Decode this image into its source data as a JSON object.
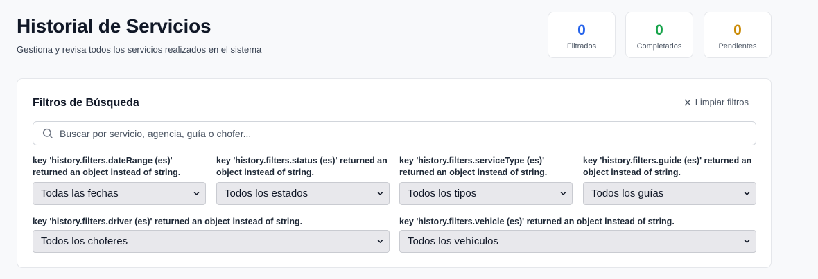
{
  "header": {
    "title": "Historial de Servicios",
    "subtitle": "Gestiona y revisa todos los servicios realizados en el sistema"
  },
  "stats": [
    {
      "value": "0",
      "label": "Filtrados",
      "color": "#2563eb"
    },
    {
      "value": "0",
      "label": "Completados",
      "color": "#16a34a"
    },
    {
      "value": "0",
      "label": "Pendientes",
      "color": "#ca8a04"
    }
  ],
  "filters": {
    "title": "Filtros de Búsqueda",
    "clear_label": "Limpiar filtros",
    "search_placeholder": "Buscar por servicio, agencia, guía o chofer...",
    "date_range": {
      "label": "key 'history.filters.dateRange (es)' returned an object instead of string.",
      "value": "Todas las fechas"
    },
    "status": {
      "label": "key 'history.filters.status (es)' returned an object instead of string.",
      "value": "Todos los estados"
    },
    "service_type": {
      "label": "key 'history.filters.serviceType (es)' returned an object instead of string.",
      "value": "Todos los tipos"
    },
    "guide": {
      "label": "key 'history.filters.guide (es)' returned an object instead of string.",
      "value": "Todos los guías"
    },
    "driver": {
      "label": "key 'history.filters.driver (es)' returned an object instead of string.",
      "value": "Todos los choferes"
    },
    "vehicle": {
      "label": "key 'history.filters.vehicle (es)' returned an object instead of string.",
      "value": "Todos los vehículos"
    }
  }
}
